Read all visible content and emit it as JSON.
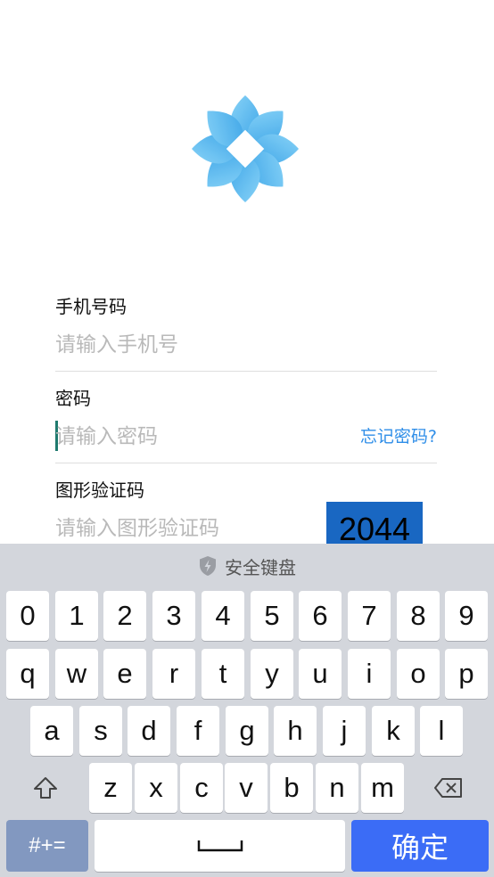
{
  "form": {
    "phone_label": "手机号码",
    "phone_placeholder": "请输入手机号",
    "password_label": "密码",
    "password_placeholder": "请输入密码",
    "forgot_link": "忘记密码?",
    "captcha_label": "图形验证码",
    "captcha_placeholder": "请输入图形验证码",
    "captcha_code": "2044"
  },
  "keyboard": {
    "title": "安全键盘",
    "row_numbers": [
      "0",
      "1",
      "2",
      "3",
      "4",
      "5",
      "6",
      "7",
      "8",
      "9"
    ],
    "row_top": [
      "q",
      "w",
      "e",
      "r",
      "t",
      "y",
      "u",
      "i",
      "o",
      "p"
    ],
    "row_mid": [
      "a",
      "s",
      "d",
      "f",
      "g",
      "h",
      "j",
      "k",
      "l"
    ],
    "row_bottom": [
      "z",
      "x",
      "c",
      "v",
      "b",
      "n",
      "m"
    ],
    "symbols_key": "#+=",
    "confirm_key": "确定",
    "icons": {
      "shift": "shift-icon",
      "backspace": "backspace-icon",
      "space": "space-icon",
      "shield": "shield-icon"
    }
  },
  "colors": {
    "accent": "#3b6cf6",
    "link": "#2f8ee8",
    "logo": "#3aa8e8"
  }
}
